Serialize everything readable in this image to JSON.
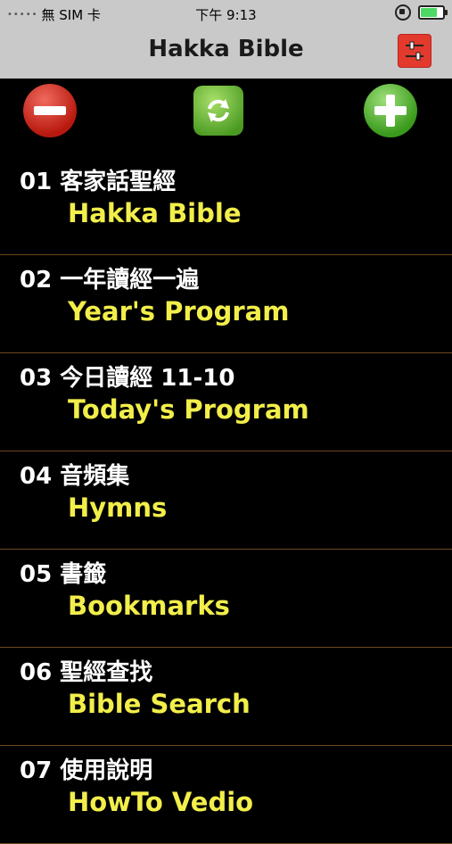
{
  "status_bar": {
    "carrier": "無 SIM 卡",
    "time": "下午 9:13"
  },
  "nav": {
    "title": "Hakka Bible"
  },
  "toolbar": {
    "remove_icon": "minus-icon",
    "refresh_icon": "refresh-icon",
    "add_icon": "plus-icon"
  },
  "menu": {
    "items": [
      {
        "title": "01 客家話聖經",
        "subtitle": "Hakka Bible"
      },
      {
        "title": "02 一年讀經一遍",
        "subtitle": "Year's Program"
      },
      {
        "title": "03 今日讀經  11-10",
        "subtitle": "Today's Program"
      },
      {
        "title": "04 音頻集",
        "subtitle": "Hymns"
      },
      {
        "title": "05 書籤",
        "subtitle": "Bookmarks"
      },
      {
        "title": "06 聖經查找",
        "subtitle": "Bible Search"
      },
      {
        "title": "07 使用說明",
        "subtitle": "HowTo Vedio"
      }
    ]
  },
  "colors": {
    "background": "#000000",
    "header": "#c9c9c9",
    "title_text": "#ffffff",
    "subtitle_text": "#f2ee4a",
    "divider": "#6b4a1f"
  }
}
